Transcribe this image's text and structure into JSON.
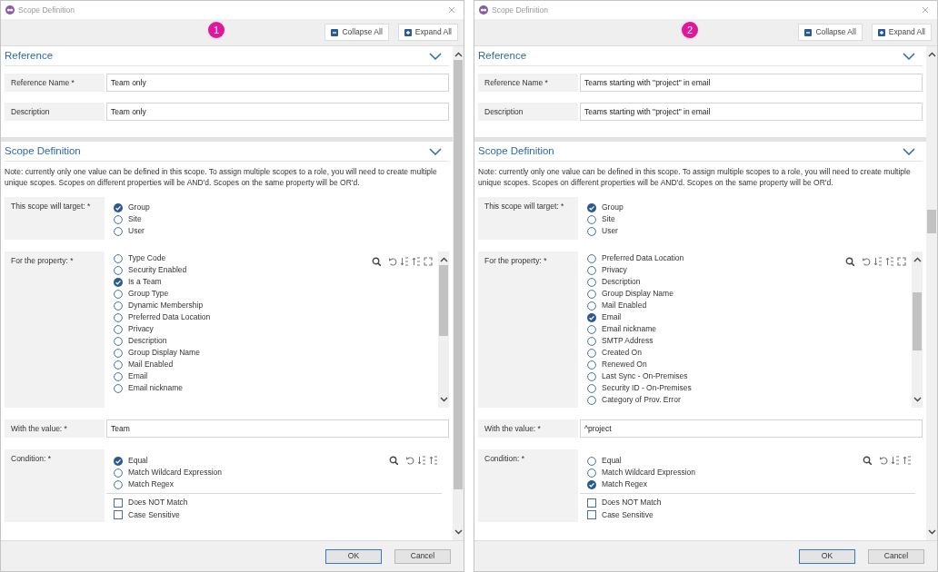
{
  "dialogs": [
    {
      "title": "Scope Definition",
      "badge": "1",
      "toolbar": [
        {
          "kind": "collapse",
          "label": "Collapse All"
        },
        {
          "kind": "expand",
          "label": "Expand All"
        }
      ],
      "reference": {
        "title": "Reference",
        "fields": [
          {
            "label": "Reference Name *",
            "value": "Team only"
          },
          {
            "label": "Description",
            "value": "Team only"
          }
        ]
      },
      "scope": {
        "title": "Scope Definition",
        "note": "Note: currently only one value can be defined in this scope. To assign multiple scopes to a role, you will need to create multiple unique scopes. Scopes on different properties will be AND'd. Scopes on the same property will be OR'd.",
        "target": {
          "label": "This scope will target: *",
          "options": [
            {
              "label": "Group",
              "selected": true
            },
            {
              "label": "Site",
              "selected": false
            },
            {
              "label": "User",
              "selected": false
            }
          ]
        },
        "property": {
          "label": "For the property: *",
          "options": [
            {
              "label": "Type Code",
              "selected": false
            },
            {
              "label": "Security Enabled",
              "selected": false
            },
            {
              "label": "Is a Team",
              "selected": true
            },
            {
              "label": "Group Type",
              "selected": false
            },
            {
              "label": "Dynamic Membership",
              "selected": false
            },
            {
              "label": "Preferred Data Location",
              "selected": false
            },
            {
              "label": "Privacy",
              "selected": false
            },
            {
              "label": "Description",
              "selected": false
            },
            {
              "label": "Group Display Name",
              "selected": false
            },
            {
              "label": "Mail Enabled",
              "selected": false
            },
            {
              "label": "Email",
              "selected": false
            },
            {
              "label": "Email nickname",
              "selected": false
            }
          ]
        },
        "value": {
          "label": "With the value: *",
          "value": "Team"
        },
        "condition": {
          "label": "Condition: *",
          "options": [
            {
              "label": "Equal",
              "selected": true
            },
            {
              "label": "Match Wildcard Expression",
              "selected": false
            },
            {
              "label": "Match Regex",
              "selected": false
            }
          ],
          "flags": [
            {
              "label": "Does NOT Match",
              "checked": false
            },
            {
              "label": "Case Sensitive",
              "checked": false
            }
          ]
        }
      },
      "buttons": [
        {
          "label": "OK",
          "default": true
        },
        {
          "label": "Cancel",
          "default": false
        }
      ]
    },
    {
      "title": "Scope Definition",
      "badge": "2",
      "toolbar": [
        {
          "kind": "collapse",
          "label": "Collapse All"
        },
        {
          "kind": "expand",
          "label": "Expand All"
        }
      ],
      "reference": {
        "title": "Reference",
        "fields": [
          {
            "label": "Reference Name *",
            "value": "Teams starting with \"project\" in email"
          },
          {
            "label": "Description",
            "value": "Teams starting with \"project\" in email"
          }
        ]
      },
      "scope": {
        "title": "Scope Definition",
        "note": "Note: currently only one value can be defined in this scope. To assign multiple scopes to a role, you will need to create multiple unique scopes. Scopes on different properties will be AND'd. Scopes on the same property will be OR'd.",
        "target": {
          "label": "This scope will target: *",
          "options": [
            {
              "label": "Group",
              "selected": true
            },
            {
              "label": "Site",
              "selected": false
            },
            {
              "label": "User",
              "selected": false
            }
          ]
        },
        "property": {
          "label": "For the property: *",
          "options": [
            {
              "label": "Preferred Data Location",
              "selected": false
            },
            {
              "label": "Privacy",
              "selected": false
            },
            {
              "label": "Description",
              "selected": false
            },
            {
              "label": "Group Display Name",
              "selected": false
            },
            {
              "label": "Mail Enabled",
              "selected": false
            },
            {
              "label": "Email",
              "selected": true
            },
            {
              "label": "Email nickname",
              "selected": false
            },
            {
              "label": "SMTP Address",
              "selected": false
            },
            {
              "label": "Created On",
              "selected": false
            },
            {
              "label": "Renewed On",
              "selected": false
            },
            {
              "label": "Last Sync - On-Premises",
              "selected": false
            },
            {
              "label": "Security ID - On-Premises",
              "selected": false
            },
            {
              "label": "Category of Prov. Error",
              "selected": false
            }
          ]
        },
        "value": {
          "label": "With the value: *",
          "value": "^project"
        },
        "condition": {
          "label": "Condition: *",
          "options": [
            {
              "label": "Equal",
              "selected": false
            },
            {
              "label": "Match Wildcard Expression",
              "selected": false
            },
            {
              "label": "Match Regex",
              "selected": true
            }
          ],
          "flags": [
            {
              "label": "Does NOT Match",
              "checked": false
            },
            {
              "label": "Case Sensitive",
              "checked": false
            }
          ]
        }
      },
      "buttons": [
        {
          "label": "OK",
          "default": true
        },
        {
          "label": "Cancel",
          "default": false
        }
      ]
    }
  ]
}
